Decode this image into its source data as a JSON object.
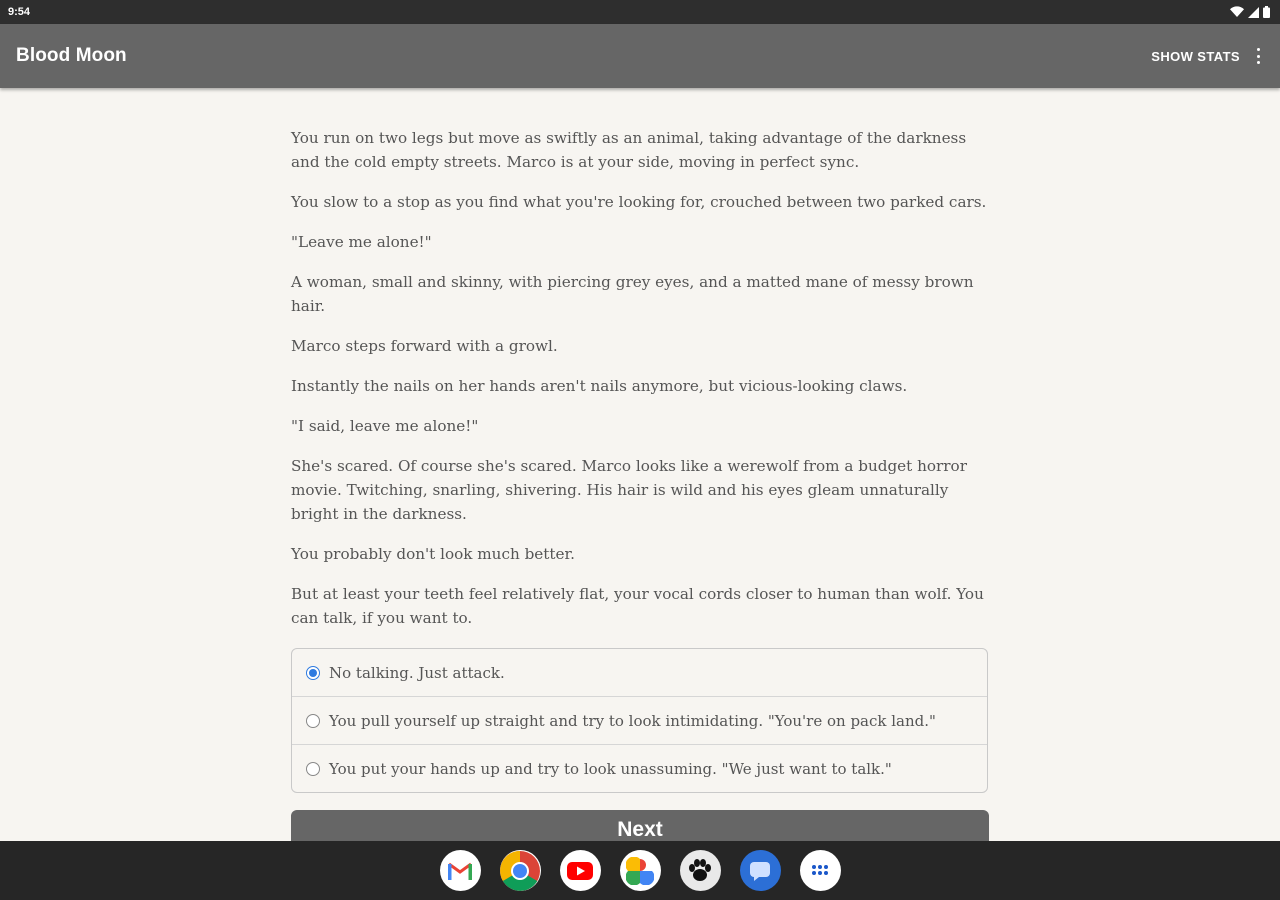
{
  "status_bar": {
    "time": "9:54",
    "icons": [
      "wifi-icon",
      "cellular-signal-icon",
      "battery-icon"
    ]
  },
  "app_bar": {
    "title": "Blood Moon",
    "show_stats_label": "SHOW STATS",
    "overflow_icon": "more-vert-icon"
  },
  "story": {
    "paragraphs": [
      "You run on two legs but move as swiftly as an animal, taking advantage of the darkness and the cold empty streets. Marco is at your side, moving in perfect sync.",
      "You slow to a stop as you find what you're looking for, crouched between two parked cars.",
      "\"Leave me alone!\"",
      "A woman, small and skinny, with piercing grey eyes, and a matted mane of messy brown hair.",
      "Marco steps forward with a growl.",
      "Instantly the nails on her hands aren't nails anymore, but vicious-looking claws.",
      "\"I said, leave me alone!\"",
      "She's scared. Of course she's scared. Marco looks like a werewolf from a budget horror movie. Twitching, snarling, shivering. His hair is wild and his eyes gleam unnaturally bright in the darkness.",
      "You probably don't look much better.",
      "But at least your teeth feel relatively flat, your vocal cords closer to human than wolf. You can talk, if you want to."
    ]
  },
  "choices": [
    {
      "label": "No talking. Just attack.",
      "selected": true
    },
    {
      "label": "You pull yourself up straight and try to look intimidating. \"You're on pack land.\"",
      "selected": false
    },
    {
      "label": "You put your hands up and try to look unassuming. \"We just want to talk.\"",
      "selected": false
    }
  ],
  "next_button": {
    "label": "Next"
  },
  "dock": {
    "apps": [
      "gmail-icon",
      "chrome-icon",
      "youtube-icon",
      "photos-icon",
      "paw-print-app-icon",
      "messages-icon",
      "app-drawer-icon"
    ]
  },
  "colors": {
    "app_bar": "#666666",
    "status_bar": "#2e2e2e",
    "background": "#f7f5f1",
    "radio_selected": "#2f7be0",
    "nav_bar": "#262626"
  }
}
